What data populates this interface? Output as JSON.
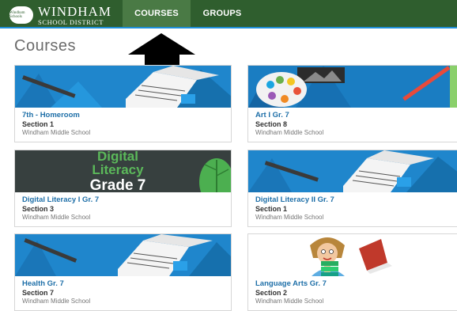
{
  "header": {
    "logo_badge": "Windham Schools",
    "logo_line1": "WINDHAM",
    "logo_line2": "SCHOOL DISTRICT",
    "colors": {
      "bar": "#2f5e2e",
      "active_tab": "#4a7a45",
      "accent": "#1e8fd8"
    },
    "tabs": [
      {
        "label": "COURSES",
        "active": true
      },
      {
        "label": "GROUPS",
        "active": false
      }
    ]
  },
  "main": {
    "title": "Courses",
    "cards": [
      {
        "title": "7th - Homeroom",
        "section": "Section 1",
        "school": "Windham Middle School",
        "image": "open-book-on-blue"
      },
      {
        "title": "Art I Gr. 7",
        "section": "Section 8",
        "school": "Windham Middle School",
        "image": "paint-palette-on-blue"
      },
      {
        "title": "Digital Literacy I Gr. 7",
        "section": "Section 3",
        "school": "Windham Middle School",
        "image": "digital-literacy-grade-7-banner",
        "image_text": [
          "Digital",
          "Literacy",
          "Grade 7"
        ]
      },
      {
        "title": "Digital Literacy II Gr. 7",
        "section": "Section 1",
        "school": "Windham Middle School",
        "image": "open-book-on-blue"
      },
      {
        "title": "Health Gr. 7",
        "section": "Section 7",
        "school": "Windham Middle School",
        "image": "open-book-on-blue"
      },
      {
        "title": "Language Arts Gr. 7",
        "section": "Section 2",
        "school": "Windham Middle School",
        "image": "cartoon-reader-with-books"
      }
    ]
  }
}
